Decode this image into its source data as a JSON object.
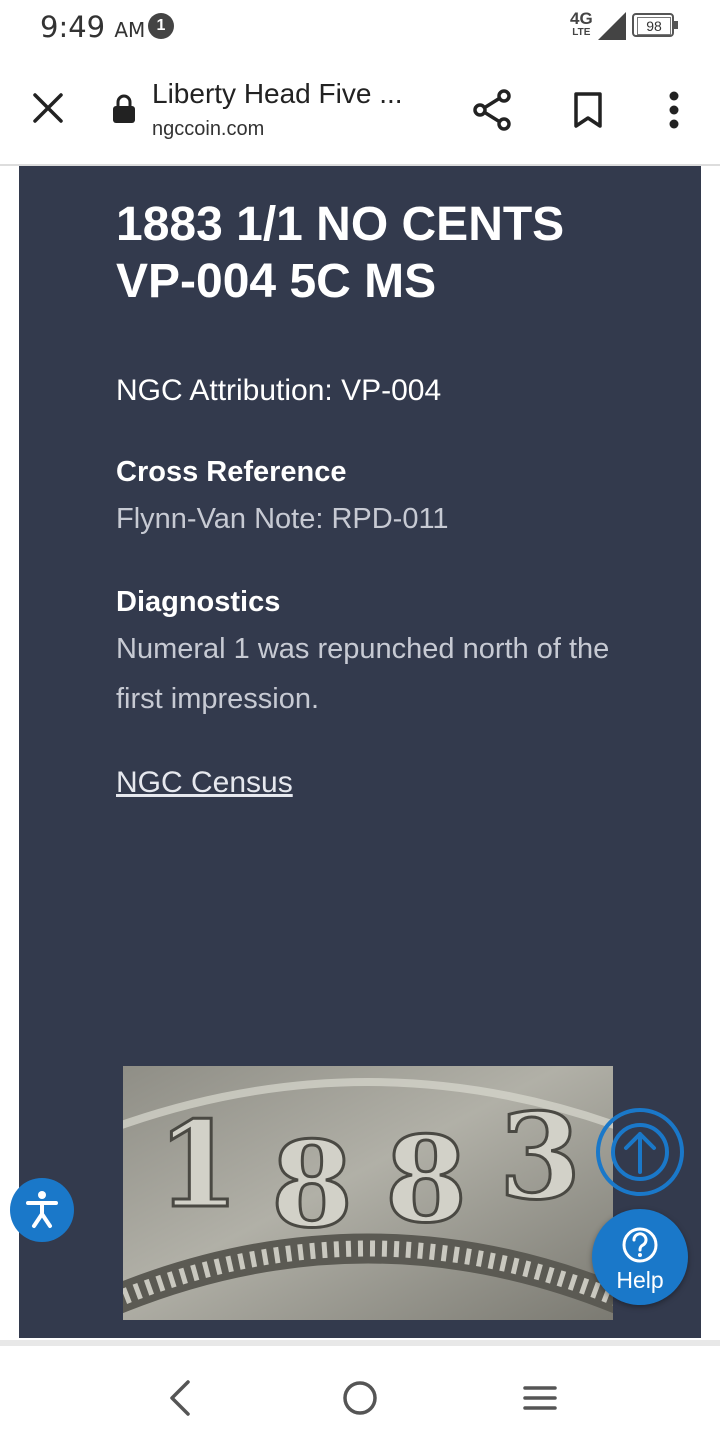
{
  "status": {
    "time": "9:49",
    "ampm": "AM",
    "notification_count": "1",
    "network_type": "4G",
    "network_sub": "LTE",
    "battery": "98"
  },
  "browser": {
    "page_title": "Liberty Head Five ...",
    "domain": "ngccoin.com"
  },
  "article": {
    "title": "1883 1/1 NO CENTS VP-004 5C MS",
    "attribution": "NGC Attribution: VP-004",
    "cross_reference_heading": "Cross Reference",
    "cross_reference_text": "Flynn-Van Note: RPD-011",
    "diagnostics_heading": "Diagnostics",
    "diagnostics_text": "Numeral 1 was repunched north of the first impression.",
    "census_link": "NGC Census"
  },
  "coin_image": {
    "digits": [
      "1",
      "8",
      "8",
      "3"
    ]
  },
  "widgets": {
    "help_label": "Help"
  },
  "colors": {
    "content_bg": "#333a4d",
    "accent_blue": "#1a78c9"
  }
}
